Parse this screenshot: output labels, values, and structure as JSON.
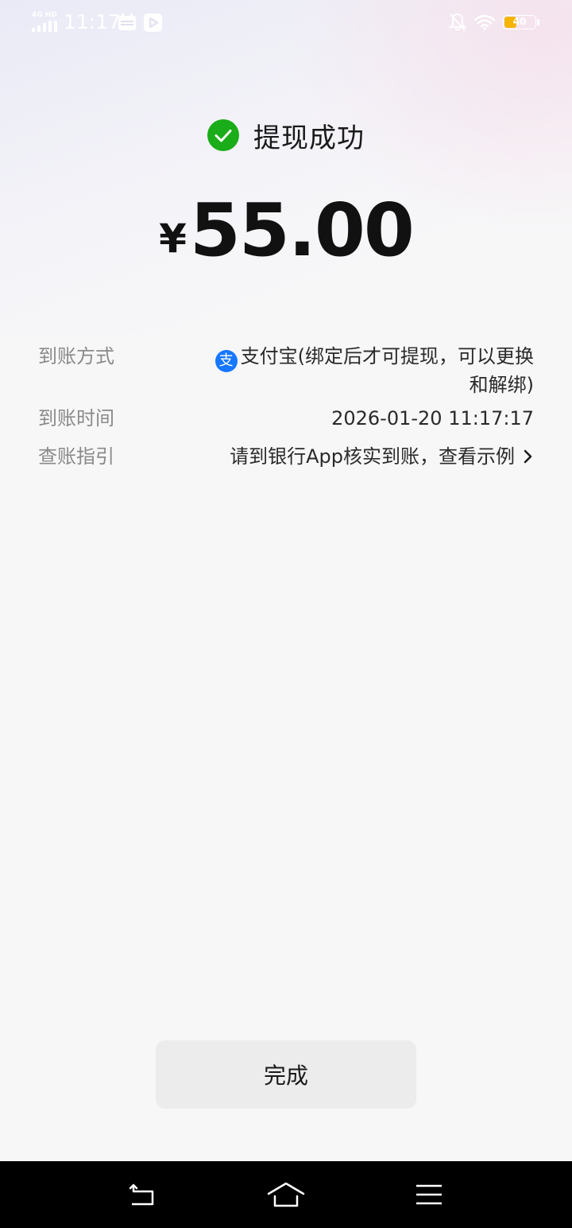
{
  "status_bar": {
    "network": "4G HD",
    "time": "11:17",
    "battery_level": "40",
    "battery_fraction": 0.4,
    "battery_color": "#f5b400"
  },
  "result": {
    "title": "提现成功",
    "icon": "check-circle-icon",
    "icon_color": "#1aad19",
    "currency": "¥",
    "amount": "55.00"
  },
  "details": {
    "method": {
      "label": "到账方式",
      "icon": "alipay-icon",
      "icon_glyph": "支",
      "icon_color": "#1677ff",
      "value_line1": "支付宝(绑定后才可提现，可以更换",
      "value_line2": "和解绑)"
    },
    "time": {
      "label": "到账时间",
      "value": "2026-01-20 11:17:17"
    },
    "guide": {
      "label": "查账指引",
      "value": "请到银行App核实到账，查看示例"
    }
  },
  "done_button": {
    "label": "完成"
  },
  "nav_bar": {
    "back": "back-icon",
    "home": "home-icon",
    "menu": "menu-icon"
  }
}
